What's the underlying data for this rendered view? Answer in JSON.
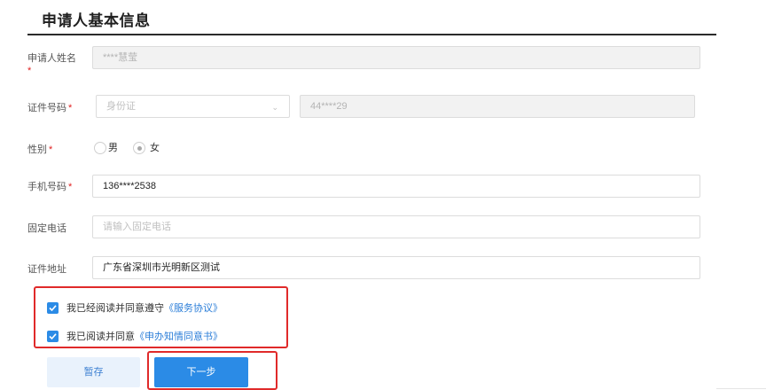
{
  "section": {
    "title": "申请人基本信息"
  },
  "form": {
    "name": {
      "label": "申请人姓名",
      "required_mark": "*",
      "value": "****慧莹"
    },
    "id_number": {
      "label": "证件号码",
      "required_mark": "*",
      "id_type": "身份证",
      "value": "44****29"
    },
    "gender": {
      "label": "性别",
      "required_mark": "*",
      "options": [
        {
          "label": "男",
          "checked": false
        },
        {
          "label": "女",
          "checked": true
        }
      ]
    },
    "phone": {
      "label": "手机号码",
      "required_mark": "*",
      "value": "136****2538"
    },
    "landline": {
      "label": "固定电话",
      "placeholder": "请输入固定电话"
    },
    "address": {
      "label": "证件地址",
      "value": "广东省深圳市光明新区测试"
    }
  },
  "agreements": [
    {
      "checked": true,
      "text": "我已经阅读并同意遵守",
      "link": "《服务协议》"
    },
    {
      "checked": true,
      "text": "我已阅读并同意",
      "link": "《申办知情同意书》"
    }
  ],
  "buttons": {
    "save": "暂存",
    "next": "下一步"
  },
  "colors": {
    "accent": "#2b8be6",
    "required": "#e02020",
    "highlight": "#e02a2a"
  }
}
